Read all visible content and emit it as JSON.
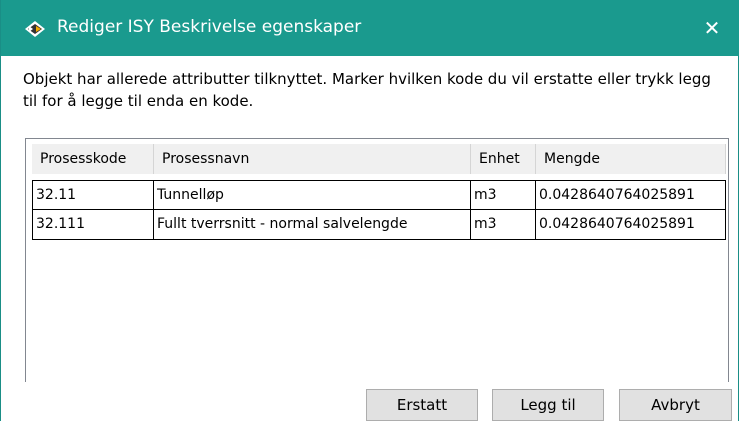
{
  "window": {
    "title": "Rediger ISY Beskrivelse egenskaper",
    "close_label": "✕"
  },
  "message": "Objekt har allerede attributter tilknyttet. Marker hvilken kode du vil erstatte eller trykk legg til for å legge til enda en kode.",
  "table": {
    "columns": [
      "Prosesskode",
      "Prosessnavn",
      "Enhet",
      "Mengde"
    ],
    "rows": [
      [
        "32.11",
        "Tunnelløp",
        "m3",
        "0.0428640764025891"
      ],
      [
        "32.111",
        "Fullt tverrsnitt - normal salvelengde",
        "m3",
        "0.0428640764025891"
      ]
    ]
  },
  "buttons": {
    "replace": "Erstatt",
    "add": "Legg til",
    "cancel": "Avbryt"
  },
  "colors": {
    "titlebar": "#1a9a8e",
    "header_bg": "#f0f0f0",
    "button_bg": "#e1e1e1"
  }
}
